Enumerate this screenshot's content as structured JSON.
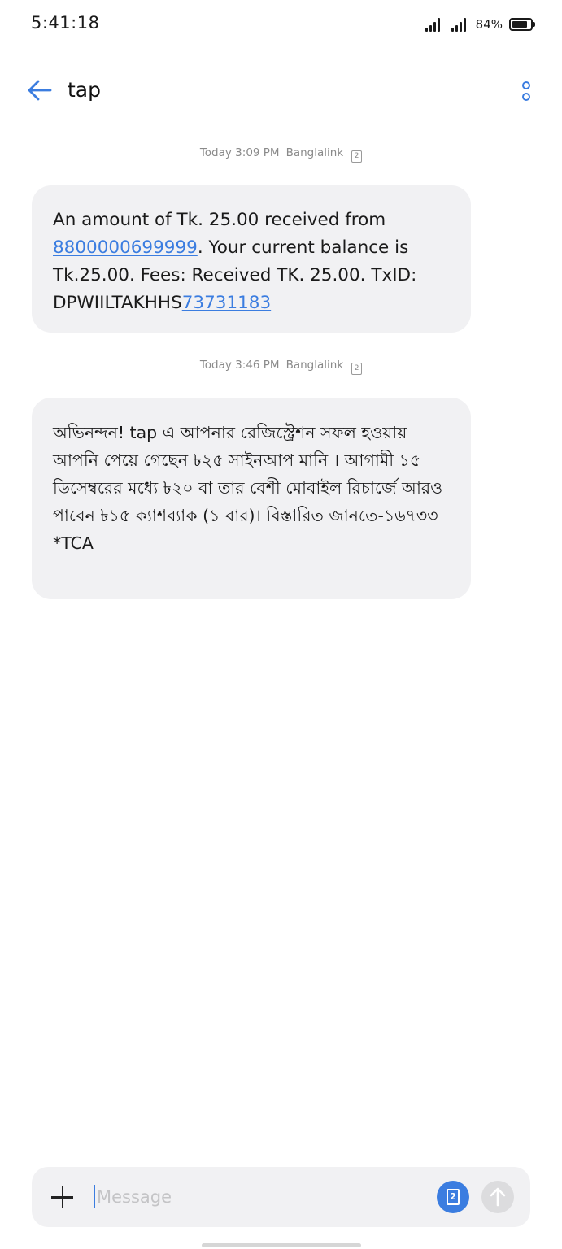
{
  "status_bar": {
    "time": "5:41:18",
    "battery": "84%"
  },
  "header": {
    "title": "tap"
  },
  "messages": [
    {
      "time": "Today 3:09 PM",
      "carrier": "Banglalink",
      "sim": "2",
      "parts": {
        "t1": "An amount of Tk. 25.00 received from ",
        "link1": "8800000699999",
        "t2": ". Your current balance is Tk.25.00. Fees:  Received TK. 25.00. TxID: DPWIILTAKHHS",
        "link2": "73731183"
      }
    },
    {
      "time": "Today 3:46 PM",
      "carrier": "Banglalink",
      "sim": "2",
      "body": "অভিনন্দন! tap এ আপনার রেজিস্ট্রেশন সফল হওয়ায় আপনি পেয়ে গেছেন ৳২৫ সাইনআপ মানি । আগামী ১৫ ডিসেম্বরের মধ্যে ৳২০ বা তার বেশী মোবাইল রিচার্জে আরও পাবেন ৳১৫ ক্যাশব্যাক (১ বার)। বিস্তারিত জানতে-১৬৭৩৩",
      "footer": "*TCA"
    }
  ],
  "compose": {
    "placeholder": "Message",
    "sim": "2"
  },
  "colors": {
    "accent": "#3b7de0",
    "bubble": "#f1f1f3",
    "meta_text": "#8a8a8a"
  }
}
